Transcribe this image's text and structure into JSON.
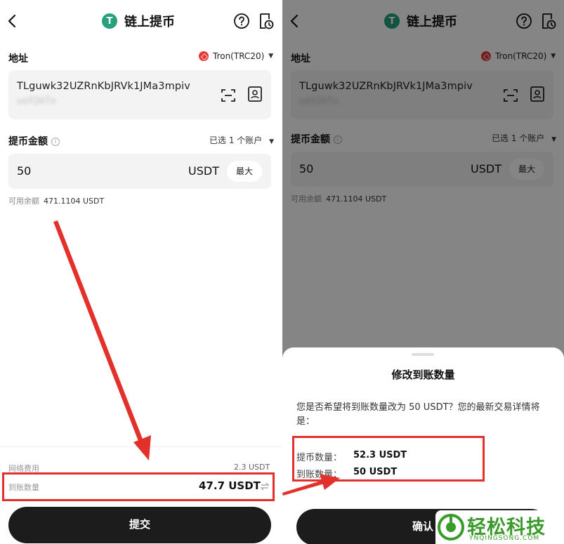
{
  "screen_left": {
    "title": "链上提币",
    "address_label": "地址",
    "network": "Tron(TRC20)",
    "address_line1": "TLguwk32UZRnKbJRVk1JMa3mpiv",
    "address_line2": "uoY2kTx",
    "amount_label": "提币金额",
    "info_glyph": "i",
    "account_select": "已选 1 个账户",
    "amount_value": "50",
    "amount_unit": "USDT",
    "max_label": "最大",
    "balance_label": "可用余额",
    "balance_value": "471.1104 USDT",
    "fee_label": "网络费用",
    "fee_value": "2.3 USDT",
    "receive_label": "到账数量",
    "receive_value": "47.7 USDT",
    "submit_label": "提交"
  },
  "screen_right": {
    "title": "链上提币",
    "address_label": "地址",
    "network": "Tron(TRC20)",
    "address_line1": "TLguwk32UZRnKbJRVk1JMa3mpiv",
    "address_line2": "uoY2kTx",
    "amount_label": "提币金额",
    "info_glyph": "i",
    "account_select": "已选 1 个账户",
    "amount_value": "50",
    "amount_unit": "USDT",
    "max_label": "最大",
    "balance_label": "可用余额",
    "balance_value": "471.1104 USDT",
    "sheet": {
      "title": "修改到账数量",
      "message": "您是否希望将到账数量改为 50 USDT？您的最新交易详情将是：",
      "withdraw_label": "提币数量：",
      "withdraw_value": "52.3 USDT",
      "receive_label": "到账数量：",
      "receive_value": "50 USDT",
      "confirm_label": "确认"
    }
  },
  "watermark": {
    "text": "轻松科技",
    "sub": "YNQINGSONG.COM"
  },
  "colors": {
    "accent_red": "#e3302a",
    "usdt_green": "#26a17b",
    "tron_red": "#e53935",
    "button_dark": "#1c1c1c",
    "watermark_green": "#3a9b2a"
  },
  "icons": [
    "back-icon",
    "usdt-icon",
    "help-icon",
    "history-icon",
    "tron-icon",
    "scan-icon",
    "address-book-icon",
    "swap-icon"
  ]
}
